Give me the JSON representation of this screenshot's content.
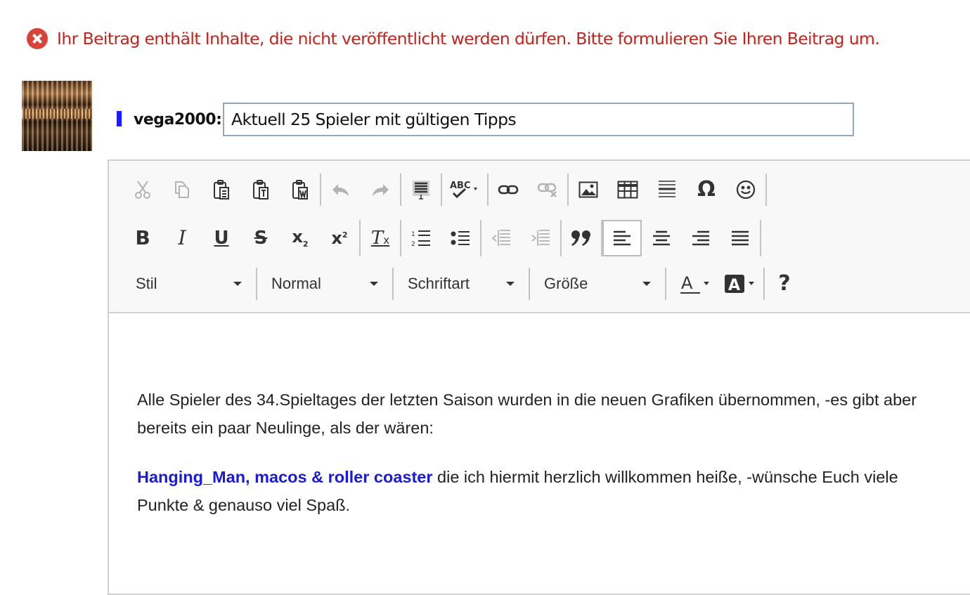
{
  "error": {
    "icon": "error-circle-icon",
    "message": "Ihr Beitrag enthält Inhalte, die nicht veröffentlicht werden dürfen. Bitte formulieren Sie Ihren Beitrag um.",
    "color": "#c7221c"
  },
  "post": {
    "username": "vega2000:",
    "subject_value": "Aktuell 25 Spieler mit gültigen Tipps"
  },
  "toolbar": {
    "row1": [
      "cut-icon",
      "copy-icon",
      "paste-icon",
      "paste-text-icon",
      "paste-word-icon",
      "undo-icon",
      "redo-icon",
      "select-all-icon",
      "spellcheck-icon",
      "link-icon",
      "unlink-icon",
      "image-icon",
      "table-icon",
      "horizontal-line-icon",
      "special-char-icon",
      "smiley-icon"
    ],
    "row2": [
      "bold-icon",
      "italic-icon",
      "underline-icon",
      "strikethrough-icon",
      "subscript-icon",
      "superscript-icon",
      "remove-format-icon",
      "numbered-list-icon",
      "bulleted-list-icon",
      "outdent-icon",
      "indent-icon",
      "blockquote-icon",
      "align-left-icon",
      "align-center-icon",
      "align-right-icon",
      "justify-icon"
    ],
    "combos": {
      "style": "Stil",
      "format": "Normal",
      "font": "Schriftart",
      "size": "Größe"
    },
    "special_char_glyph": "Ω",
    "help_glyph": "?"
  },
  "content": {
    "paragraph1": "Alle Spieler des 34.Spieltages der letzten Saison wurden in die neuen Grafiken übernommen, -es gibt aber bereits ein paar Neulinge, als der wären:",
    "paragraph2_highlight": "Hanging_Man, macos & roller coaster",
    "paragraph2_rest": " die ich hiermit herzlich willkommen heiße, -wünsche Euch viele Punkte & genauso viel Spaß.",
    "highlight_color": "#1a1adb"
  }
}
